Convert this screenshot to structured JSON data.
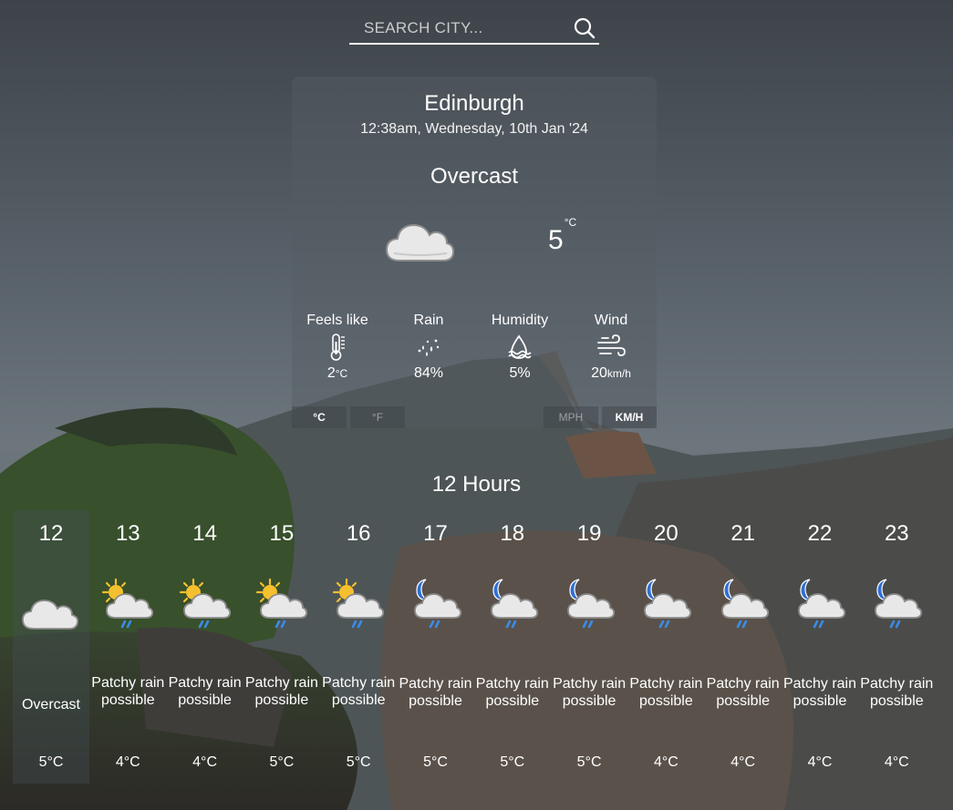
{
  "search": {
    "placeholder": "SEARCH CITY...",
    "icon": "search-icon"
  },
  "current": {
    "city": "Edinburgh",
    "datetime": "12:38am, Wednesday, 10th Jan '24",
    "condition": "Overcast",
    "icon": "cloud-icon",
    "temp": "5",
    "temp_unit": "°C"
  },
  "stats": [
    {
      "label": "Feels like",
      "icon": "thermometer-icon",
      "value": "2",
      "unit": "°C"
    },
    {
      "label": "Rain",
      "icon": "rain-drops-icon",
      "value": "84%",
      "unit": ""
    },
    {
      "label": "Humidity",
      "icon": "humidity-icon",
      "value": "5%",
      "unit": ""
    },
    {
      "label": "Wind",
      "icon": "wind-icon",
      "value": "20",
      "unit": "km/h"
    }
  ],
  "units": {
    "celsius": "°C",
    "fahrenheit": "°F",
    "mph": "MPH",
    "kmh": "KM/H",
    "selected_temp": "celsius",
    "selected_speed": "kmh"
  },
  "hours_title": "12 Hours",
  "hours": [
    {
      "hour": "12",
      "icon": "overcast-cloud-icon",
      "desc": "Overcast",
      "temp": "5°C"
    },
    {
      "hour": "13",
      "icon": "sun-cloud-rain-icon",
      "desc": "Patchy rain possible",
      "temp": "4°C"
    },
    {
      "hour": "14",
      "icon": "sun-cloud-rain-icon",
      "desc": "Patchy rain possible",
      "temp": "4°C"
    },
    {
      "hour": "15",
      "icon": "sun-cloud-rain-icon",
      "desc": "Patchy rain possible",
      "temp": "5°C"
    },
    {
      "hour": "16",
      "icon": "sun-cloud-rain-icon",
      "desc": "Patchy rain possible",
      "temp": "5°C"
    },
    {
      "hour": "17",
      "icon": "moon-cloud-rain-icon",
      "desc": "Patchy rain possible",
      "temp": "5°C"
    },
    {
      "hour": "18",
      "icon": "moon-cloud-rain-icon",
      "desc": "Patchy rain possible",
      "temp": "5°C"
    },
    {
      "hour": "19",
      "icon": "moon-cloud-rain-icon",
      "desc": "Patchy rain possible",
      "temp": "5°C"
    },
    {
      "hour": "20",
      "icon": "moon-cloud-rain-icon",
      "desc": "Patchy rain possible",
      "temp": "4°C"
    },
    {
      "hour": "21",
      "icon": "moon-cloud-rain-icon",
      "desc": "Patchy rain possible",
      "temp": "4°C"
    },
    {
      "hour": "22",
      "icon": "moon-cloud-rain-icon",
      "desc": "Patchy rain possible",
      "temp": "4°C"
    },
    {
      "hour": "23",
      "icon": "moon-cloud-rain-icon",
      "desc": "Patchy rain possible",
      "temp": "4°C"
    }
  ],
  "colors": {
    "text": "#ffffff",
    "card_bg": "#555c64",
    "cloud": "#e9e9e9",
    "sun": "#f5c02e",
    "moon": "#2f6fd6",
    "rain": "#3b8be8"
  }
}
